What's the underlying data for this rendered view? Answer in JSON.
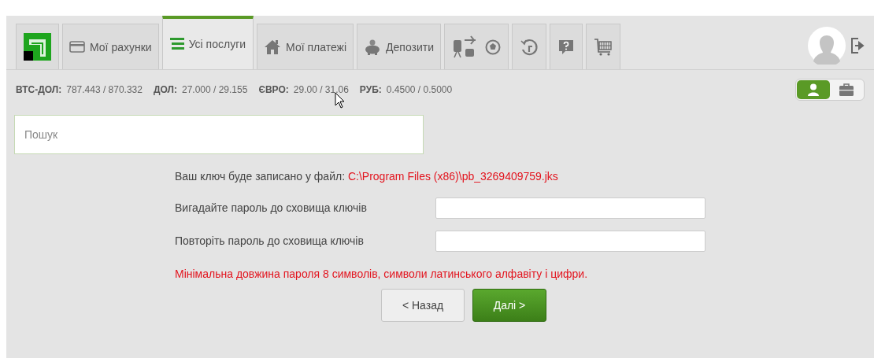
{
  "tabs": [
    {
      "kind": "logo",
      "selected": false
    },
    {
      "kind": "label",
      "label": "Мої рахунки",
      "selected": false
    },
    {
      "kind": "label",
      "label": "Усі послуги",
      "selected": true
    },
    {
      "kind": "label",
      "label": "Мої платежі",
      "selected": false
    },
    {
      "kind": "label",
      "label": "Депозити",
      "selected": false
    },
    {
      "kind": "icons",
      "selected": false
    },
    {
      "kind": "icons",
      "selected": false
    },
    {
      "kind": "icons",
      "selected": false
    },
    {
      "kind": "icons",
      "selected": false
    }
  ],
  "rates": [
    {
      "label": "ВТС-ДОЛ:",
      "value": "787.443 / 870.332"
    },
    {
      "label": "ДОЛ:",
      "value": "27.000 / 29.155"
    },
    {
      "label": "ЄВРО:",
      "value": "29.00 / 31.06"
    },
    {
      "label": "РУБ:",
      "value": "0.4500 / 0.5000"
    }
  ],
  "roles": [
    {
      "selected": true
    },
    {
      "selected": false
    }
  ],
  "search": {
    "placeholder": "Пошук"
  },
  "key_file": {
    "label": "Ваш ключ буде записано у файл:",
    "path": "C:\\Program Files (x86)\\pb_3269409759.jks"
  },
  "fields": [
    {
      "label": "Вигадайте пароль до сховища ключів"
    },
    {
      "label": "Повторіть пароль до сховища ключів"
    }
  ],
  "note": "Мінімальна довжина пароля 8 символів, символи латинського алфавіту і цифри.",
  "buttons": [
    {
      "label": "< Назад",
      "kind": "secondary"
    },
    {
      "label": "Далі >",
      "kind": "primary"
    }
  ]
}
